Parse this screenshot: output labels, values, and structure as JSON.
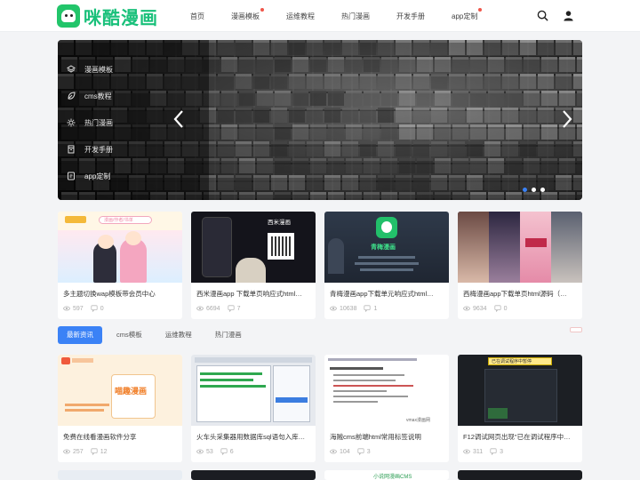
{
  "header": {
    "logo_text": "咪酷漫画",
    "nav": [
      {
        "label": "首页",
        "dot": false
      },
      {
        "label": "漫画模板",
        "dot": true
      },
      {
        "label": "运维教程",
        "dot": false
      },
      {
        "label": "热门漫画",
        "dot": false
      },
      {
        "label": "开发手册",
        "dot": false
      },
      {
        "label": "app定制",
        "dot": true
      }
    ],
    "icons": [
      "search-icon",
      "user-icon"
    ]
  },
  "banner": {
    "menu": [
      {
        "label": "漫画模板",
        "icon": "layers-icon"
      },
      {
        "label": "cms教程",
        "icon": "leaf-icon"
      },
      {
        "label": "热门漫画",
        "icon": "sun-icon"
      },
      {
        "label": "开发手册",
        "icon": "book-icon"
      },
      {
        "label": "app定制",
        "icon": "app-icon"
      }
    ],
    "slide_count": 3,
    "active_slide": 1
  },
  "row1": [
    {
      "title": "多主题切换wap模板带会员中心",
      "views": "597",
      "comments": "0",
      "thumb_text": "漫画/作者/书单",
      "thumb_kind": "pink"
    },
    {
      "title": "西米漫画app 下载单页响应式html…",
      "views": "6694",
      "comments": "7",
      "thumb_text": "西米漫画",
      "thumb_kind": "dark-phone"
    },
    {
      "title": "青梅漫画app下载单元响应式html…",
      "views": "10638",
      "comments": "1",
      "thumb_text": "青梅漫画",
      "thumb_kind": "green-app"
    },
    {
      "title": "西梅漫画app下载单页html源码（…",
      "views": "9634",
      "comments": "0",
      "thumb_text": "",
      "thumb_kind": "collage"
    }
  ],
  "tabs": [
    {
      "label": "最新资讯",
      "active": true
    },
    {
      "label": "cms模板",
      "active": false
    },
    {
      "label": "运维教程",
      "active": false
    },
    {
      "label": "热门漫画",
      "active": false
    }
  ],
  "row2": [
    {
      "title": "免费在线看漫画软件分享",
      "views": "257",
      "comments": "12",
      "thumb_text": "喵趣漫画",
      "thumb_kind": "orange"
    },
    {
      "title": "火车头采集器用数据库sql语句入库时…",
      "views": "53",
      "comments": "6",
      "thumb_text": "",
      "thumb_kind": "window"
    },
    {
      "title": "海贼cms前端html常用标签说明",
      "views": "104",
      "comments": "3",
      "thumb_text": "vmax漫画网",
      "thumb_kind": "doc"
    },
    {
      "title": "F12调试网页出现\"已在调试程序中暂…",
      "views": "311",
      "comments": "3",
      "thumb_text": "已在调试程序中暂停",
      "thumb_kind": "dark-debug"
    }
  ],
  "row3_thumb_text": [
    "",
    "",
    "小说网漫画CMS",
    ""
  ]
}
